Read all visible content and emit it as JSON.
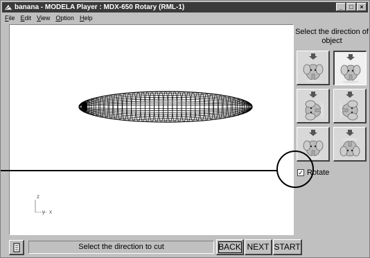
{
  "window": {
    "title": "banana - MODELA Player  : MDX-650 Rotary (RML-1)",
    "controls": {
      "minimize": "_",
      "maximize": "□",
      "close": "×"
    }
  },
  "menu": {
    "items": [
      {
        "label": "File"
      },
      {
        "label": "Edit"
      },
      {
        "label": "View"
      },
      {
        "label": "Option"
      },
      {
        "label": "Help"
      }
    ]
  },
  "side_panel": {
    "title": "Select the direction of object",
    "rotate_label": "Rotate",
    "rotate_checked": true,
    "direction_buttons": [
      {
        "name": "top",
        "selected": false
      },
      {
        "name": "front",
        "selected": true
      },
      {
        "name": "left",
        "selected": false
      },
      {
        "name": "right",
        "selected": false
      },
      {
        "name": "back",
        "selected": false
      },
      {
        "name": "bottom",
        "selected": false
      }
    ]
  },
  "viewport": {
    "axis": {
      "z": "z",
      "y": "y",
      "x": "x"
    }
  },
  "status": {
    "message": "Select the direction to cut",
    "buttons": {
      "back": "BACK",
      "next": "NEXT",
      "start": "START"
    }
  },
  "colors": {
    "titlebar": "#3a3a3a",
    "face": "#c0c0c0",
    "viewport": "#ffffff",
    "mesh": "#000000"
  },
  "icons": [
    "app-icon",
    "minimize-icon",
    "maximize-icon",
    "close-icon",
    "printer-icon",
    "arrow-down-icon",
    "elephant-icon"
  ]
}
